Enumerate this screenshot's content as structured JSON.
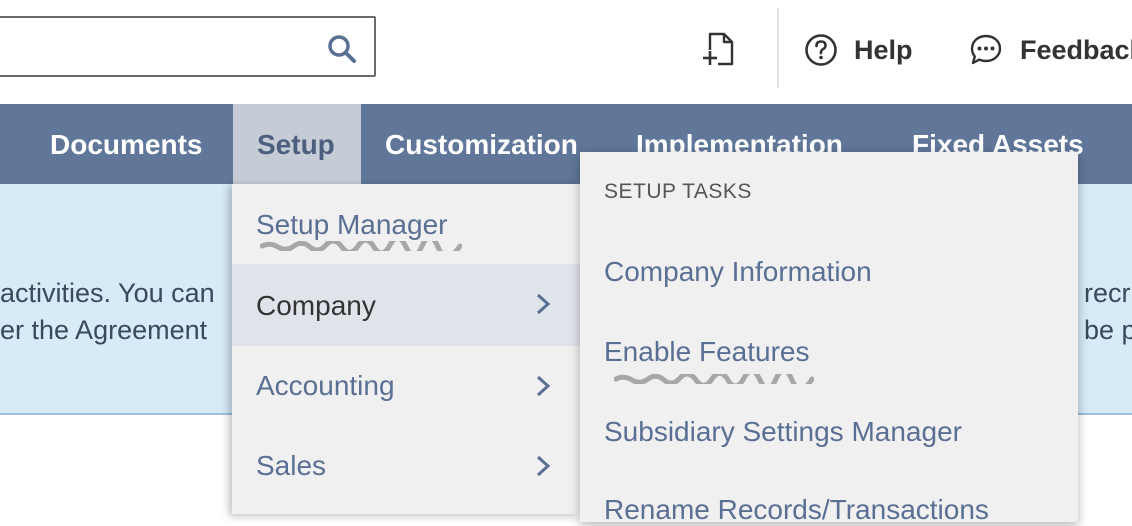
{
  "header": {
    "search": {
      "value": ""
    },
    "new_record_icon": "page-plus-icon",
    "help_label": "Help",
    "feedback_label": "Feedback"
  },
  "navbar": {
    "items": [
      {
        "label": "Documents"
      },
      {
        "label": "Setup",
        "active": true
      },
      {
        "label": "Customization"
      },
      {
        "label": "Implementation"
      },
      {
        "label": "Fixed Assets"
      }
    ],
    "bar_color": "#607799",
    "active_color": "#c5ccd6"
  },
  "banner": {
    "line1_left": "activities. You can",
    "line2_left": "er the Agreement",
    "line1_right": "recr",
    "line2_right": "be p"
  },
  "setup_menu": {
    "items": [
      {
        "label": "Setup Manager",
        "has_submenu": false
      },
      {
        "label": "Company",
        "has_submenu": true,
        "hover": true
      },
      {
        "label": "Accounting",
        "has_submenu": true
      },
      {
        "label": "Sales",
        "has_submenu": true
      }
    ]
  },
  "submenu": {
    "heading": "SETUP TASKS",
    "items": [
      {
        "label": "Company Information"
      },
      {
        "label": "Enable Features"
      },
      {
        "label": "Subsidiary Settings Manager"
      },
      {
        "label": "Rename Records/Transactions"
      }
    ]
  }
}
